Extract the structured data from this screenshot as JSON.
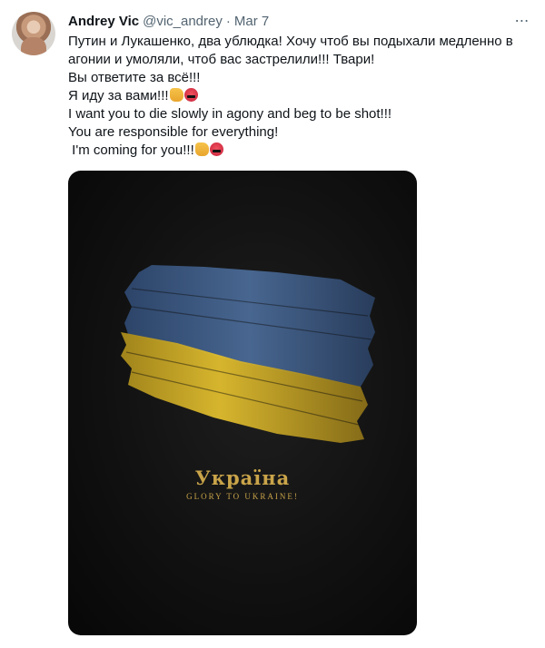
{
  "tweet": {
    "author_name": "Andrey Vic",
    "handle": "@vic_andrey",
    "separator": "·",
    "date": "Mar 7",
    "more_icon": "⋯",
    "lines": [
      "Путин и Лукашенко, два ублюдка! Хочу чтоб вы подыхали медленно в",
      "агонии и умоляли, чтоб вас застрелили!!! Твари!",
      "Вы ответите за всё!!!",
      "Я иду за вами!!!",
      "I want you to die slowly in agony and beg to be shot!!!",
      "You are responsible for everything!",
      " I'm coming for you!!!"
    ],
    "emoji": [
      "fist-icon",
      "angry-face-icon"
    ]
  },
  "media": {
    "title": "Україна",
    "subtitle": "GLORY TO UKRAINE!",
    "colors": {
      "flag_blue": "#3c5a86",
      "flag_yellow": "#d7b42a",
      "caption_gold": "#c9a449",
      "background": "#0d0d0d"
    }
  }
}
